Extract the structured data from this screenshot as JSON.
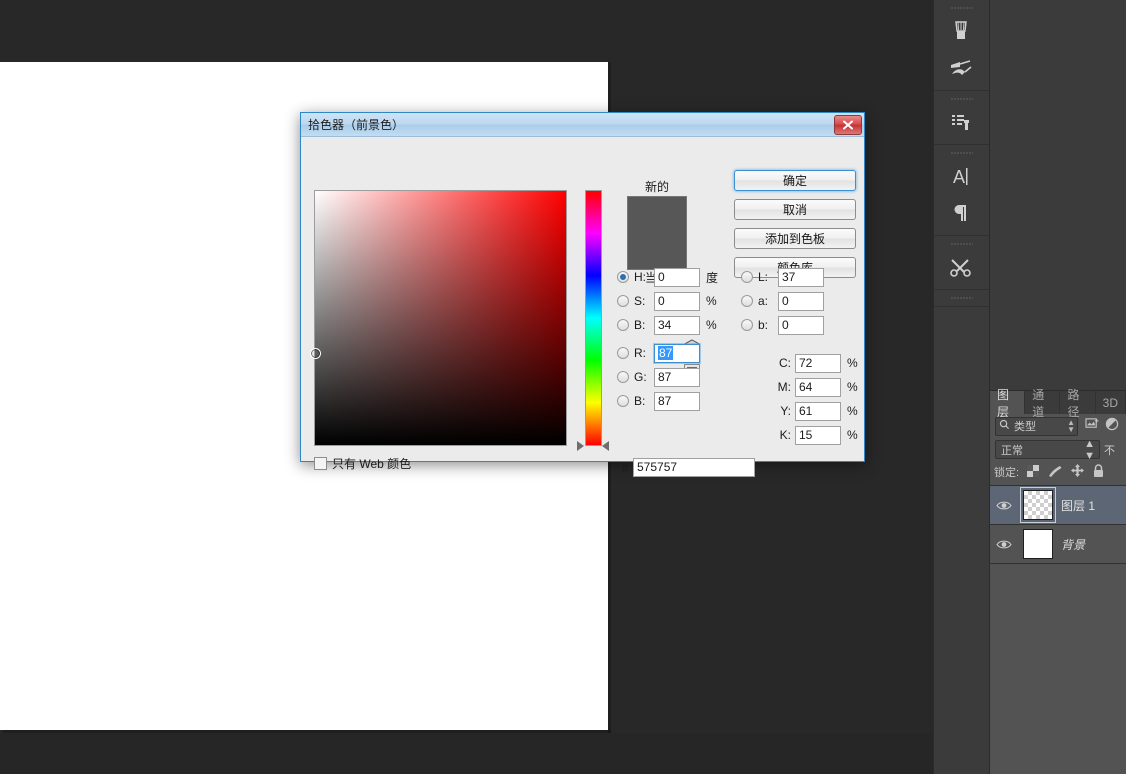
{
  "dialog": {
    "title": "拾色器（前景色）",
    "close_icon": "close-icon",
    "new_label": "新的",
    "current_label": "当前",
    "web_only_label": "只有 Web 颜色",
    "hash_symbol": "#",
    "hex_value": "575757",
    "new_color": "#575757",
    "current_color": "#575757",
    "hue_color": "#ff0000",
    "buttons": {
      "ok": "确定",
      "cancel": "取消",
      "add_to_swatches": "添加到色板",
      "color_libraries": "颜色库"
    },
    "hsb": [
      {
        "label": "H:",
        "value": "0",
        "unit": "度",
        "selected": true
      },
      {
        "label": "S:",
        "value": "0",
        "unit": "%",
        "selected": false
      },
      {
        "label": "B:",
        "value": "34",
        "unit": "%",
        "selected": false
      }
    ],
    "rgb": [
      {
        "label": "R:",
        "value": "87",
        "unit": "",
        "selected": false,
        "focused": true
      },
      {
        "label": "G:",
        "value": "87",
        "unit": "",
        "selected": false,
        "focused": false
      },
      {
        "label": "B:",
        "value": "87",
        "unit": "",
        "selected": false,
        "focused": false
      }
    ],
    "lab": [
      {
        "label": "L:",
        "value": "37",
        "unit": "",
        "selected": false
      },
      {
        "label": "a:",
        "value": "0",
        "unit": "",
        "selected": false
      },
      {
        "label": "b:",
        "value": "0",
        "unit": "",
        "selected": false
      }
    ],
    "cmyk": [
      {
        "label": "C:",
        "value": "72",
        "unit": "%"
      },
      {
        "label": "M:",
        "value": "64",
        "unit": "%"
      },
      {
        "label": "Y:",
        "value": "61",
        "unit": "%"
      },
      {
        "label": "K:",
        "value": "15",
        "unit": "%"
      }
    ]
  },
  "panels": {
    "tabs": [
      {
        "label": "图层",
        "active": true
      },
      {
        "label": "通道",
        "active": false
      },
      {
        "label": "路径",
        "active": false
      },
      {
        "label": "3D",
        "active": false
      }
    ],
    "filter_value": "类型",
    "blend_mode": "正常",
    "opacity_label": "不",
    "lock_label": "锁定:",
    "layers": [
      {
        "name": "图层 1",
        "selected": true,
        "kind": "transparent"
      },
      {
        "name": "背景",
        "selected": false,
        "kind": "white"
      }
    ]
  },
  "icon_strip": [
    {
      "name": "brush-icon"
    },
    {
      "name": "brush-presets-icon"
    },
    {
      "name": "clone-source-icon"
    },
    {
      "name": "character-icon"
    },
    {
      "name": "paragraph-icon"
    },
    {
      "name": "tool-presets-icon"
    }
  ]
}
